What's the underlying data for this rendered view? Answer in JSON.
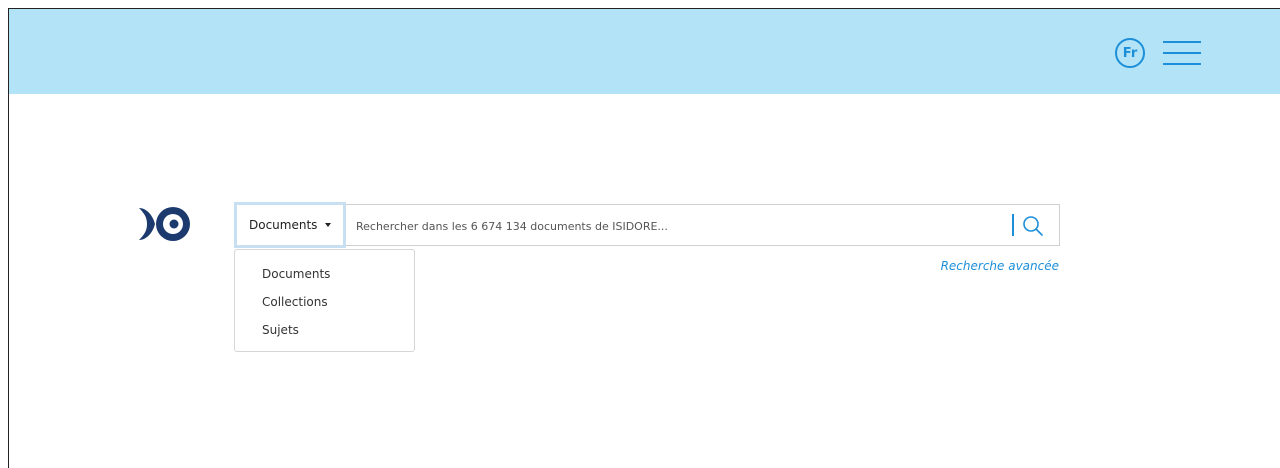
{
  "header": {
    "language_label": "Fr",
    "menu_icon": "hamburger-menu-icon",
    "background_color": "#b3e3f7",
    "accent_color": "#1d8fd8"
  },
  "logo": {
    "icon": "isidore-fish-logo"
  },
  "search": {
    "scope_selected": "Documents",
    "placeholder": "Rechercher dans les 6 674 134 documents de ISIDORE...",
    "search_icon": "search-icon",
    "advanced_link": "Recherche avancée"
  },
  "scope_dropdown": {
    "options": [
      "Documents",
      "Collections",
      "Sujets"
    ]
  }
}
